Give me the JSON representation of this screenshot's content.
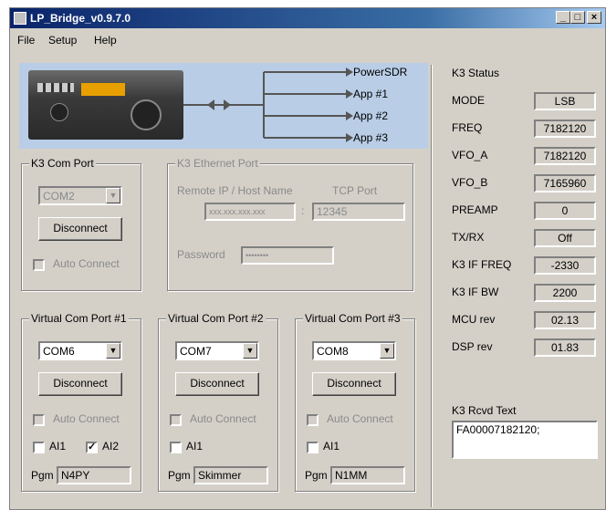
{
  "window": {
    "title": "LP_Bridge_v0.9.7.0"
  },
  "titlebar_buttons": {
    "minimize": "_",
    "maximize": "□",
    "close": "×"
  },
  "menu": [
    "File",
    "Setup",
    "Help"
  ],
  "banner": {
    "labels": [
      "PowerSDR",
      "App #1",
      "App #2",
      "App #3"
    ]
  },
  "k3com": {
    "legend": "K3 Com Port",
    "port": "COM2",
    "button": "Disconnect",
    "auto_connect": "Auto Connect"
  },
  "ethernet": {
    "legend": "K3 Ethernet Port",
    "remote_ip_label": "Remote IP / Host Name",
    "tcp_port_label": "TCP Port",
    "ip_value": "xxx.xxx.xxx.xxx",
    "colon": ":",
    "port_value": "12345",
    "password_label": "Password",
    "password_value": "••••••••"
  },
  "vcom": [
    {
      "legend": "Virtual Com Port #1",
      "port": "COM6",
      "button": "Disconnect",
      "auto_connect": "Auto Connect",
      "ai1": "AI1",
      "ai2": "AI2",
      "ai1_checked": false,
      "ai2_checked": true,
      "pgm_label": "Pgm",
      "pgm": "N4PY"
    },
    {
      "legend": "Virtual Com Port #2",
      "port": "COM7",
      "button": "Disconnect",
      "auto_connect": "Auto Connect",
      "ai1": "AI1",
      "ai1_checked": false,
      "pgm_label": "Pgm",
      "pgm": "Skimmer"
    },
    {
      "legend": "Virtual Com Port #3",
      "port": "COM8",
      "button": "Disconnect",
      "auto_connect": "Auto Connect",
      "ai1": "AI1",
      "ai1_checked": false,
      "pgm_label": "Pgm",
      "pgm": "N1MM"
    }
  ],
  "status": {
    "legend": "K3 Status",
    "rows": [
      {
        "label": "MODE",
        "value": "LSB"
      },
      {
        "label": "FREQ",
        "value": "7182120"
      },
      {
        "label": "VFO_A",
        "value": "7182120"
      },
      {
        "label": "VFO_B",
        "value": "7165960"
      },
      {
        "label": "PREAMP",
        "value": "0"
      },
      {
        "label": "TX/RX",
        "value": "Off"
      },
      {
        "label": "K3 IF FREQ",
        "value": "-2330"
      },
      {
        "label": "K3 IF BW",
        "value": "2200"
      },
      {
        "label": "MCU rev",
        "value": "02.13"
      },
      {
        "label": "DSP rev",
        "value": "01.83"
      }
    ],
    "rcvd_label": "K3 Rcvd Text",
    "rcvd_text": "FA00007182120;"
  }
}
